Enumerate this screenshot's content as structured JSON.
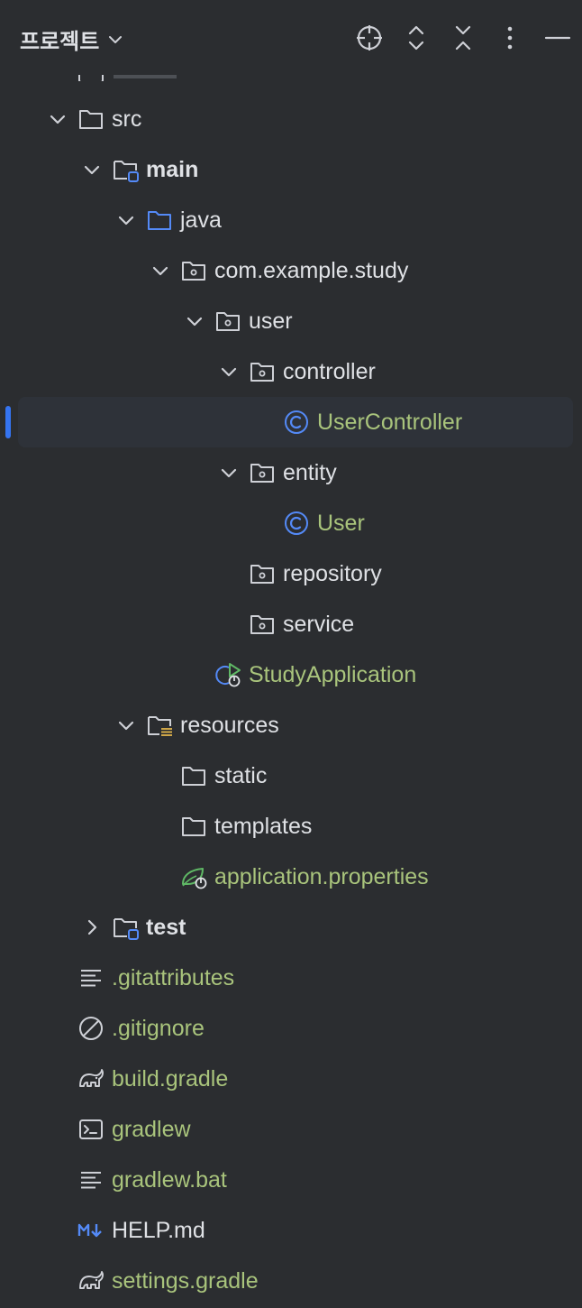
{
  "header": {
    "title": "프로젝트",
    "icons": [
      "locate-icon",
      "expand-all-icon",
      "collapse-all-icon",
      "more-options-icon",
      "minimize-icon"
    ]
  },
  "colors": {
    "background": "#2b2d30",
    "text": "#dfe1e5",
    "modified_green": "#a9c47c",
    "accent_blue": "#3574f0",
    "icon_gray": "#ced0d6"
  },
  "tree": {
    "src": "src",
    "main": "main",
    "java": "java",
    "package": "com.example.study",
    "user": "user",
    "controller": "controller",
    "user_controller": "UserController",
    "entity": "entity",
    "user_class": "User",
    "repository": "repository",
    "service": "service",
    "study_application": "StudyApplication",
    "resources": "resources",
    "static": "static",
    "templates": "templates",
    "application_properties": "application.properties",
    "test": "test",
    "gitattributes": ".gitattributes",
    "gitignore": ".gitignore",
    "build_gradle": "build.gradle",
    "gradlew": "gradlew",
    "gradlew_bat": "gradlew.bat",
    "help_md": "HELP.md",
    "settings_gradle": "settings.gradle"
  }
}
